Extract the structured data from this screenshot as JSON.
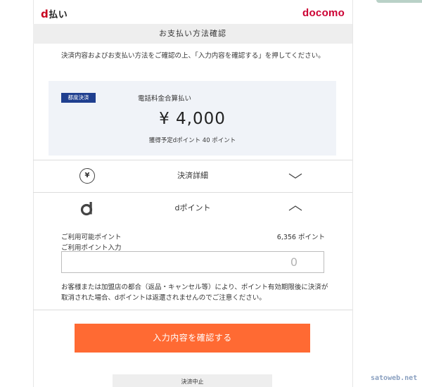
{
  "brand": {
    "dpay_logo": "払い",
    "dpay_logo_d": "d",
    "docomo_logo": "docomo"
  },
  "header": {
    "title": "お支払い方法確認"
  },
  "instructions": "決済内容およびお支払い方法をご確認の上、「入力内容を確認する」を押してください。",
  "summary": {
    "badge": "都度決済",
    "method": "電話料金合算払い",
    "amount": "¥ 4,000",
    "points_note": "獲得予定dポイント 40 ポイント"
  },
  "sections": {
    "details_label": "決済詳細",
    "details_icon": "yen-circle-icon",
    "details_icon_glyph": "¥",
    "details_state": "collapsed",
    "dpoint_label": "dポイント",
    "dpoint_icon": "d-logo-icon",
    "dpoint_state": "expanded"
  },
  "points": {
    "available_label": "ご利用可能ポイント",
    "available_value": "6,356 ポイント",
    "input_label": "ご利用ポイント入力",
    "input_value": "0"
  },
  "disclaimer": "お客様または加盟店の都合（返品・キャンセル等）により、ポイント有効期限後に決済が取消された場合、dポイントは返還されませんのでご注意ください。",
  "buttons": {
    "confirm": "入力内容を確認する",
    "cancel": "決済中止"
  },
  "watermark": "satoweb.net",
  "colors": {
    "accent_orange": "#ff6a33",
    "badge_blue": "#1f3f8f",
    "docomo_red": "#cc0033",
    "summary_bg": "#f0f3f8"
  }
}
